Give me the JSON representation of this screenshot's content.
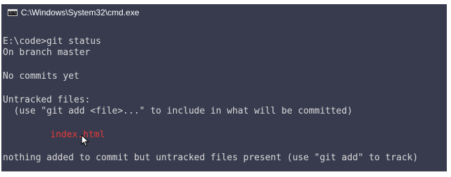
{
  "window": {
    "title": "C:\\Windows\\System32\\cmd.exe",
    "icon": "cmd-icon",
    "background": "#383b4e"
  },
  "console": {
    "prompt_line": "E:\\code>git status",
    "branch_line": "On branch master",
    "commits_line": "No commits yet",
    "untracked_header": "Untracked files:",
    "hint_line": "  (use \"git add <file>...\" to include in what will be committed)",
    "untracked_file": "index.html",
    "summary_line": "nothing added to commit but untracked files present (use \"git add\" to track)"
  },
  "colors": {
    "text": "#d9d9d9",
    "untracked": "#e83a3a"
  },
  "cursor": "arrow-pointer-icon"
}
